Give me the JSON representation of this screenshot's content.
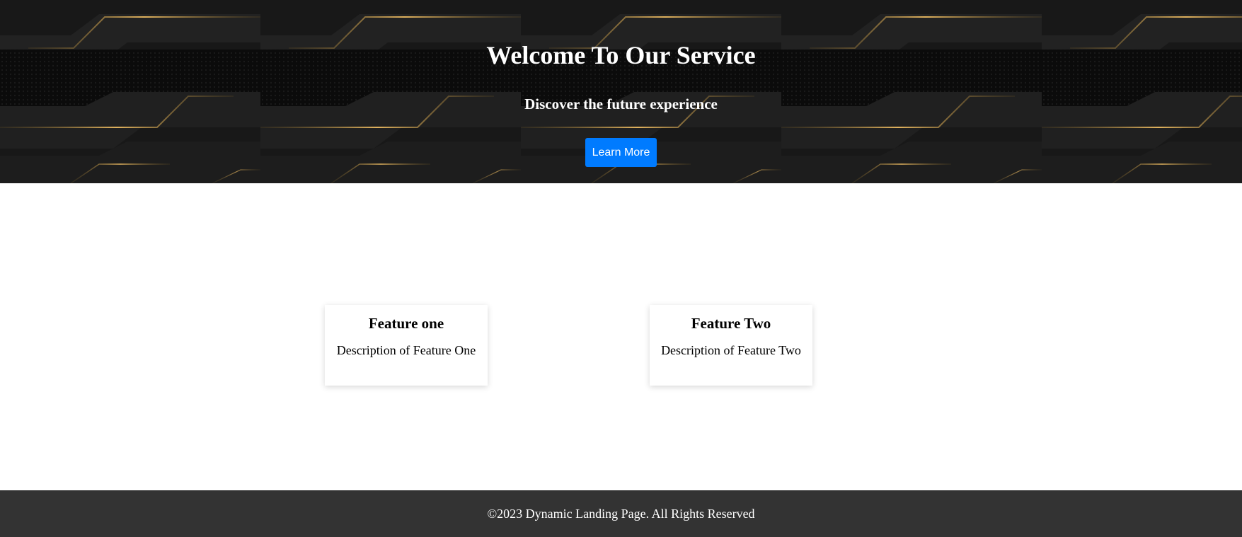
{
  "hero": {
    "title": "Welcome To Our Service",
    "subtitle": "Discover the future experience",
    "cta_label": "Learn More"
  },
  "features": [
    {
      "title": "Feature one",
      "description": "Description of Feature One"
    },
    {
      "title": "Feature Two",
      "description": "Description of Feature Two"
    }
  ],
  "footer": {
    "copyright": "©2023 Dynamic Landing Page. All Rights Reserved"
  },
  "colors": {
    "hero_background": "#161616",
    "accent_gold": "#c9a24d",
    "button": "#007bff",
    "footer_background": "#333333"
  }
}
